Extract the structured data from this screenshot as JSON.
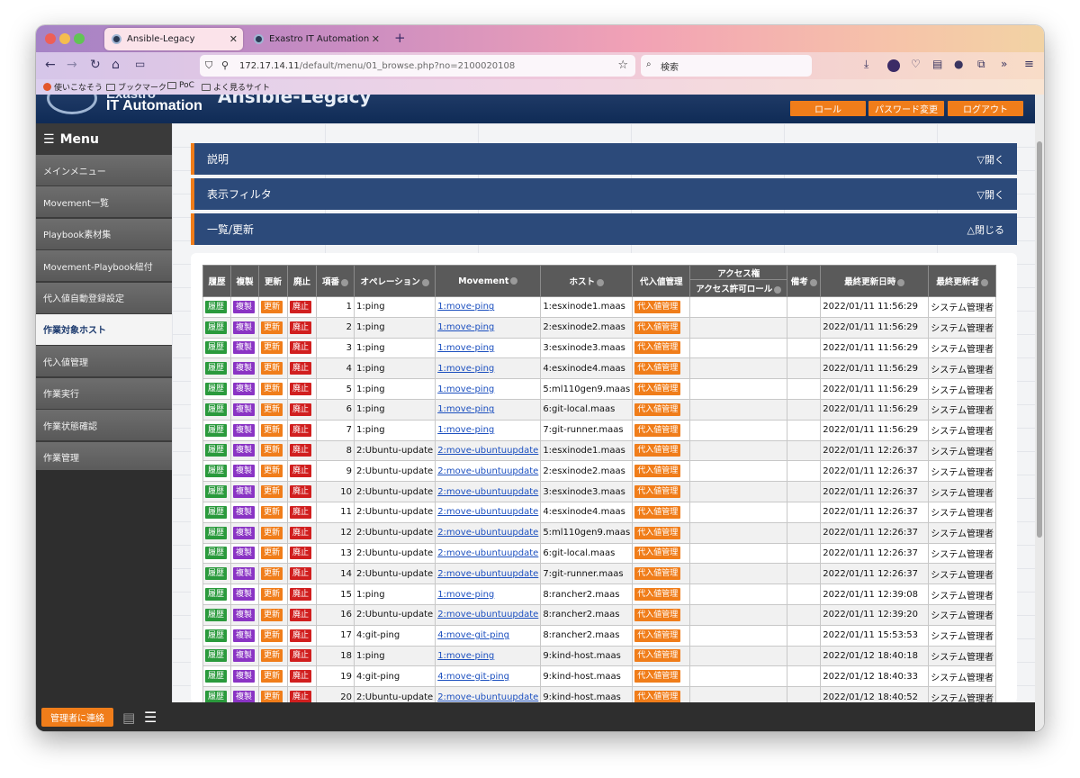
{
  "browser": {
    "tabs": [
      {
        "title": "Ansible-Legacy"
      },
      {
        "title": "Exastro IT Automation"
      }
    ],
    "url_host": "172.17.14.11",
    "url_path": "/default/menu/01_browse.php?no=2100020108",
    "search_placeholder": "検索",
    "bookmarks": [
      "使いこなそう",
      "ブックマーク",
      "PoC",
      "よく見るサイト"
    ]
  },
  "app": {
    "logo_line1": "Exastro",
    "logo_line2": "IT Automation",
    "title": "Ansible-Legacy",
    "header_buttons": [
      "ロール",
      "パスワード変更",
      "ログアウト"
    ]
  },
  "sidebar": {
    "heading": "Menu",
    "items": [
      "メインメニュー",
      "Movement一覧",
      "Playbook素材集",
      "Movement-Playbook紐付",
      "代入値自動登録設定",
      "作業対象ホスト",
      "代入値管理",
      "作業実行",
      "作業状態確認",
      "作業管理"
    ],
    "active_index": 5
  },
  "sections": [
    {
      "title": "説明",
      "toggle": "▽開く"
    },
    {
      "title": "表示フィルタ",
      "toggle": "▽開く"
    },
    {
      "title": "一覧/更新",
      "toggle": "△閉じる"
    }
  ],
  "table": {
    "headers": {
      "history": "履歴",
      "dup": "複製",
      "update": "更新",
      "discard": "廃止",
      "item_no": "項番",
      "operation": "オペレーション",
      "movement": "Movement",
      "host": "ホスト",
      "subst": "代入値管理",
      "access_group": "アクセス権",
      "access_role": "アクセス許可ロール",
      "note": "備考",
      "last_updated": "最終更新日時",
      "last_updater": "最終更新者"
    },
    "button_labels": {
      "history": "履歴",
      "dup": "複製",
      "update": "更新",
      "discard": "廃止",
      "subst": "代入値管理"
    },
    "rows": [
      {
        "no": "1",
        "op": "1:ping",
        "mv": "1:move-ping",
        "host": "1:esxinode1.maas",
        "date": "2022/01/11 11:56:29",
        "user": "システム管理者"
      },
      {
        "no": "2",
        "op": "1:ping",
        "mv": "1:move-ping",
        "host": "2:esxinode2.maas",
        "date": "2022/01/11 11:56:29",
        "user": "システム管理者"
      },
      {
        "no": "3",
        "op": "1:ping",
        "mv": "1:move-ping",
        "host": "3:esxinode3.maas",
        "date": "2022/01/11 11:56:29",
        "user": "システム管理者"
      },
      {
        "no": "4",
        "op": "1:ping",
        "mv": "1:move-ping",
        "host": "4:esxinode4.maas",
        "date": "2022/01/11 11:56:29",
        "user": "システム管理者"
      },
      {
        "no": "5",
        "op": "1:ping",
        "mv": "1:move-ping",
        "host": "5:ml110gen9.maas",
        "date": "2022/01/11 11:56:29",
        "user": "システム管理者"
      },
      {
        "no": "6",
        "op": "1:ping",
        "mv": "1:move-ping",
        "host": "6:git-local.maas",
        "date": "2022/01/11 11:56:29",
        "user": "システム管理者"
      },
      {
        "no": "7",
        "op": "1:ping",
        "mv": "1:move-ping",
        "host": "7:git-runner.maas",
        "date": "2022/01/11 11:56:29",
        "user": "システム管理者"
      },
      {
        "no": "8",
        "op": "2:Ubuntu-update",
        "mv": "2:move-ubuntuupdate",
        "host": "1:esxinode1.maas",
        "date": "2022/01/11 12:26:37",
        "user": "システム管理者"
      },
      {
        "no": "9",
        "op": "2:Ubuntu-update",
        "mv": "2:move-ubuntuupdate",
        "host": "2:esxinode2.maas",
        "date": "2022/01/11 12:26:37",
        "user": "システム管理者"
      },
      {
        "no": "10",
        "op": "2:Ubuntu-update",
        "mv": "2:move-ubuntuupdate",
        "host": "3:esxinode3.maas",
        "date": "2022/01/11 12:26:37",
        "user": "システム管理者"
      },
      {
        "no": "11",
        "op": "2:Ubuntu-update",
        "mv": "2:move-ubuntuupdate",
        "host": "4:esxinode4.maas",
        "date": "2022/01/11 12:26:37",
        "user": "システム管理者"
      },
      {
        "no": "12",
        "op": "2:Ubuntu-update",
        "mv": "2:move-ubuntuupdate",
        "host": "5:ml110gen9.maas",
        "date": "2022/01/11 12:26:37",
        "user": "システム管理者"
      },
      {
        "no": "13",
        "op": "2:Ubuntu-update",
        "mv": "2:move-ubuntuupdate",
        "host": "6:git-local.maas",
        "date": "2022/01/11 12:26:37",
        "user": "システム管理者"
      },
      {
        "no": "14",
        "op": "2:Ubuntu-update",
        "mv": "2:move-ubuntuupdate",
        "host": "7:git-runner.maas",
        "date": "2022/01/11 12:26:37",
        "user": "システム管理者"
      },
      {
        "no": "15",
        "op": "1:ping",
        "mv": "1:move-ping",
        "host": "8:rancher2.maas",
        "date": "2022/01/11 12:39:08",
        "user": "システム管理者"
      },
      {
        "no": "16",
        "op": "2:Ubuntu-update",
        "mv": "2:move-ubuntuupdate",
        "host": "8:rancher2.maas",
        "date": "2022/01/11 12:39:20",
        "user": "システム管理者"
      },
      {
        "no": "17",
        "op": "4:git-ping",
        "mv": "4:move-git-ping",
        "host": "8:rancher2.maas",
        "date": "2022/01/11 15:53:53",
        "user": "システム管理者"
      },
      {
        "no": "18",
        "op": "1:ping",
        "mv": "1:move-ping",
        "host": "9:kind-host.maas",
        "date": "2022/01/12 18:40:18",
        "user": "システム管理者"
      },
      {
        "no": "19",
        "op": "4:git-ping",
        "mv": "4:move-git-ping",
        "host": "9:kind-host.maas",
        "date": "2022/01/12 18:40:33",
        "user": "システム管理者"
      },
      {
        "no": "20",
        "op": "2:Ubuntu-update",
        "mv": "2:move-ubuntuupdate",
        "host": "9:kind-host.maas",
        "date": "2022/01/12 18:40:52",
        "user": "システム管理者"
      }
    ]
  },
  "footer": {
    "contact_label": "管理者に連絡"
  },
  "colors": {
    "header_blue": "#0f2b56",
    "section_blue": "#2c4a7a",
    "accent_orange": "#f07d1a",
    "history_green": "#2a9a3c",
    "dup_purple": "#8a34c4",
    "discard_red": "#d11f1f"
  }
}
